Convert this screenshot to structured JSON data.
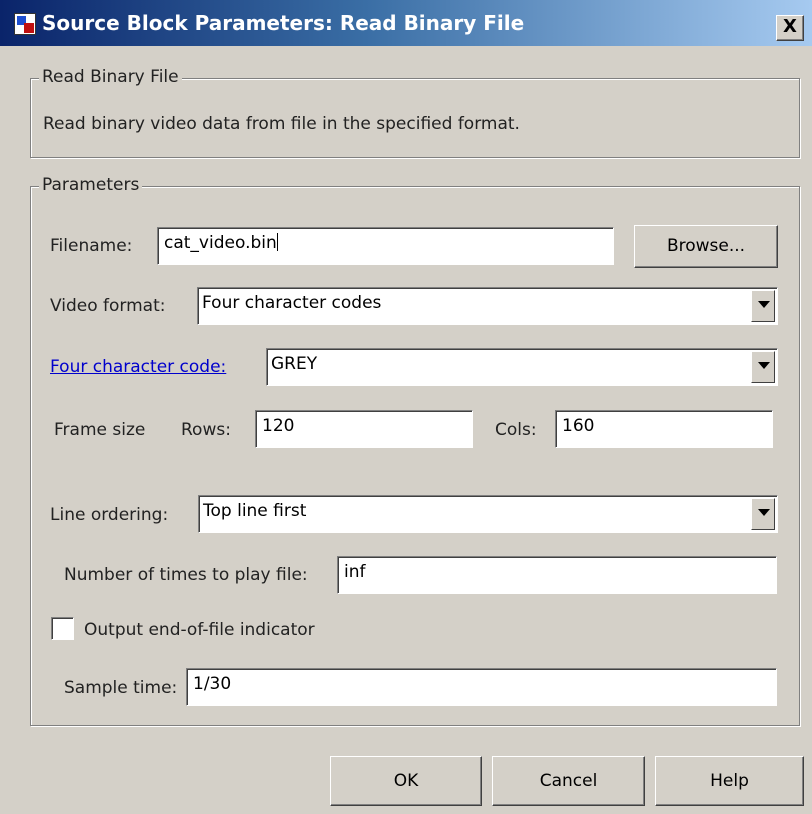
{
  "window": {
    "title": "Source Block Parameters: Read Binary File",
    "close_label": "X"
  },
  "block": {
    "group_label": "Read Binary File",
    "description": "Read binary video data from file in the specified format."
  },
  "parameters": {
    "group_label": "Parameters",
    "filename": {
      "label": "Filename:",
      "value": "cat_video.bin"
    },
    "browse_label": "Browse...",
    "video_format": {
      "label": "Video format:",
      "value": "Four character codes"
    },
    "four_cc": {
      "label": "Four character code:",
      "value": "GREY"
    },
    "frame_size": {
      "label": "Frame size",
      "rows_label": "Rows:",
      "rows_value": "120",
      "cols_label": "Cols:",
      "cols_value": "160"
    },
    "line_ordering": {
      "label": "Line ordering:",
      "value": "Top line first"
    },
    "play_count": {
      "label": "Number of times to play file:",
      "value": "inf"
    },
    "eof_indicator": {
      "label": "Output end-of-file indicator",
      "checked": false
    },
    "sample_time": {
      "label": "Sample time:",
      "value": "1/30"
    }
  },
  "buttons": {
    "ok": "OK",
    "cancel": "Cancel",
    "help": "Help"
  },
  "icons": {
    "window": "simulink-block-icon",
    "close": "close-icon",
    "dropdown": "chevron-down-icon"
  }
}
